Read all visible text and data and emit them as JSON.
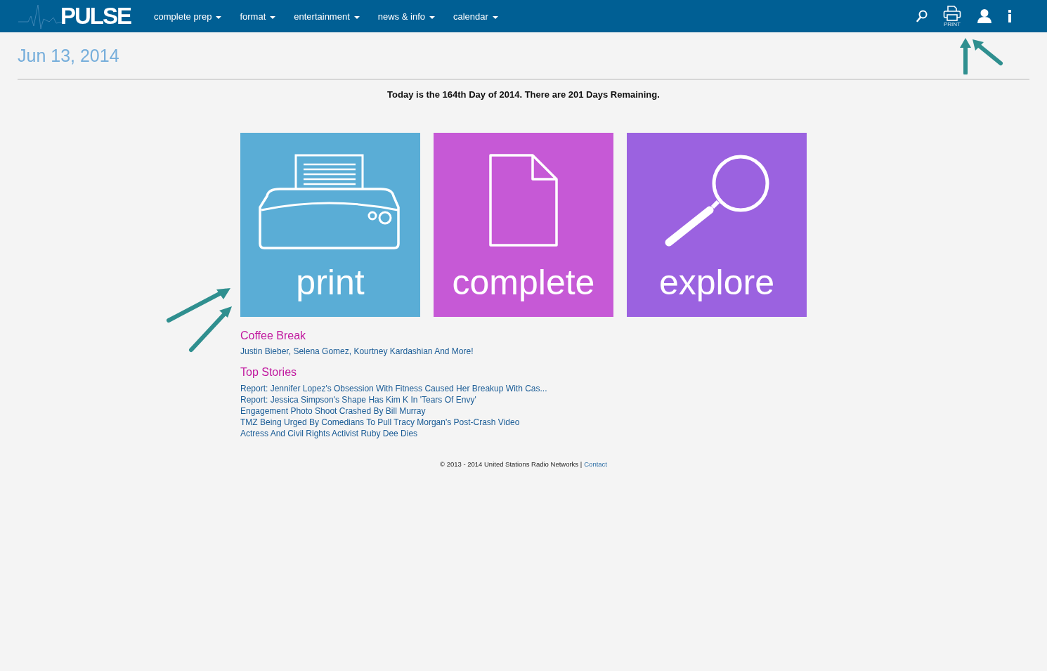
{
  "nav": {
    "logo": "PULSE",
    "menus": [
      {
        "label": "complete prep"
      },
      {
        "label": "format"
      },
      {
        "label": "entertainment"
      },
      {
        "label": "news & info"
      },
      {
        "label": "calendar"
      }
    ],
    "print_label": "PRINT"
  },
  "date": "Jun 13, 2014",
  "day_note": "Today is the 164th Day of 2014. There are 201 Days Remaining.",
  "tiles": [
    {
      "label": "print",
      "kind": "printer",
      "color": "#5aadd6"
    },
    {
      "label": "complete",
      "kind": "document",
      "color": "#c659d6"
    },
    {
      "label": "explore",
      "kind": "magnifier",
      "color": "#9b62e0"
    }
  ],
  "coffee_break": {
    "heading": "Coffee Break",
    "link": "Justin Bieber, Selena Gomez, Kourtney Kardashian And More!"
  },
  "top_stories": {
    "heading": "Top Stories",
    "links": [
      "Report: Jennifer Lopez's Obsession With Fitness Caused Her Breakup With Cas...",
      "Report: Jessica Simpson's Shape Has Kim K In 'Tears Of Envy'",
      "Engagement Photo Shoot Crashed By Bill Murray",
      "TMZ Being Urged By Comedians To Pull Tracy Morgan's Post-Crash Video",
      "Actress And Civil Rights Activist Ruby Dee Dies"
    ]
  },
  "footer": {
    "text": "© 2013 - 2014 United Stations Radio Networks |",
    "link": "Contact"
  }
}
